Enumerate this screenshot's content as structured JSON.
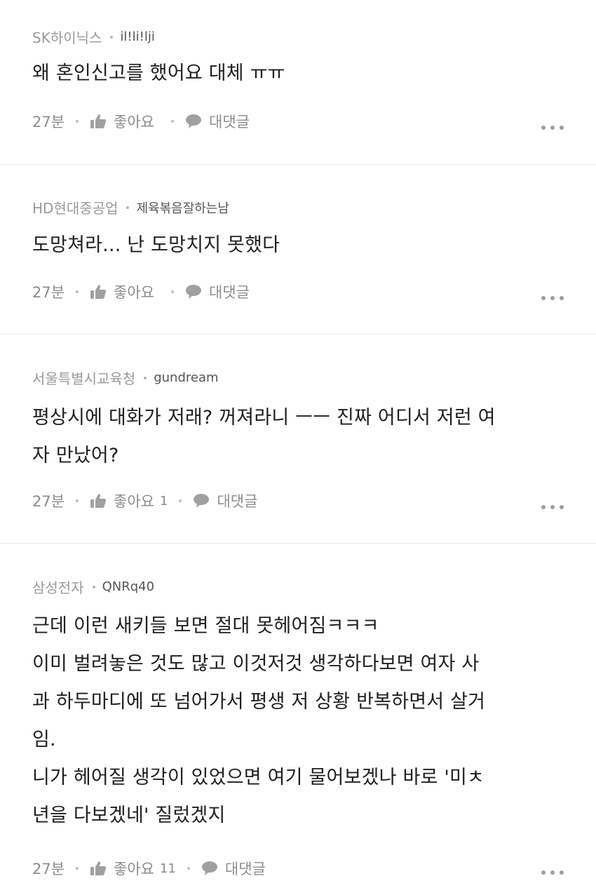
{
  "comments": [
    {
      "company": "SK하이닉스",
      "nickname": "il!li!lji",
      "text": "왜 혼인신고를 했어요 대체 ㅠㅠ",
      "time": "27분",
      "like_label": "좋아요",
      "like_count": "",
      "reply_label": "대댓글"
    },
    {
      "company": "HD현대중공업",
      "nickname": "제육볶음잘하는남",
      "text": "도망쳐라... 난 도망치지 못했다",
      "time": "27분",
      "like_label": "좋아요",
      "like_count": "",
      "reply_label": "대댓글"
    },
    {
      "company": "서울특별시교육청",
      "nickname": "gundream",
      "text": "평상시에 대화가 저래? 꺼져라니 ㅡㅡ 진짜 어디서 저런 여\n자 만났어?",
      "time": "27분",
      "like_label": "좋아요",
      "like_count": "1",
      "reply_label": "대댓글"
    },
    {
      "company": "삼성전자",
      "nickname": "QNRq40",
      "text": "근데 이런 새키들 보면 절대 못헤어짐ㅋㅋㅋ\n이미 벌려놓은 것도 많고 이것저것 생각하다보면 여자 사\n과 하두마디에 또 넘어가서 평생 저 상황 반복하면서 살거\n임.\n니가 헤어질 생각이 있었으면 여기 물어보겠나 바로 '미ㅊ\n년을 다보겠네' 질렀겠지",
      "time": "27분",
      "like_label": "좋아요",
      "like_count": "11",
      "reply_label": "대댓글"
    }
  ],
  "icons": {
    "like": "thumbs-up-icon",
    "reply": "speech-bubble-icon",
    "more": "more-dots-icon"
  },
  "colors": {
    "meta_text": "#9a9a9a",
    "body_text": "#1f1f1f",
    "divider": "#e8e8e8"
  }
}
